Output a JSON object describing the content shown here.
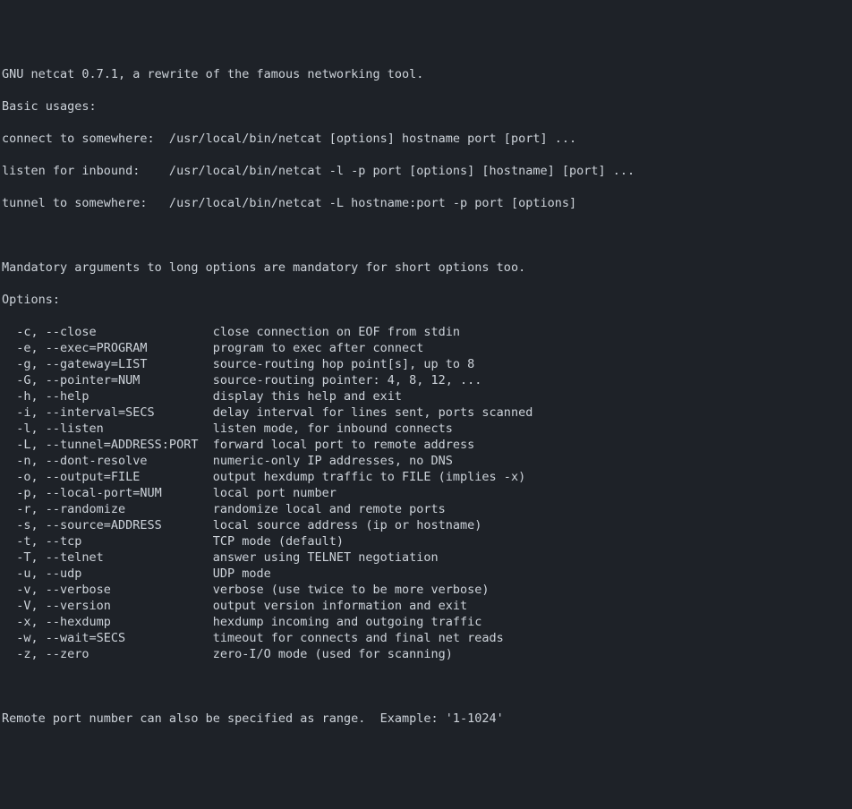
{
  "header": "GNU netcat 0.7.1, a rewrite of the famous networking tool.",
  "usages_title": "Basic usages:",
  "usages": [
    "connect to somewhere:  /usr/local/bin/netcat [options] hostname port [port] ...",
    "listen for inbound:    /usr/local/bin/netcat -l -p port [options] [hostname] [port] ...",
    "tunnel to somewhere:   /usr/local/bin/netcat -L hostname:port -p port [options]"
  ],
  "mandatory": "Mandatory arguments to long options are mandatory for short options too.",
  "options_title": "Options:",
  "options": [
    {
      "flag": "  -c, --close",
      "desc": "close connection on EOF from stdin"
    },
    {
      "flag": "  -e, --exec=PROGRAM",
      "desc": "program to exec after connect"
    },
    {
      "flag": "  -g, --gateway=LIST",
      "desc": "source-routing hop point[s], up to 8"
    },
    {
      "flag": "  -G, --pointer=NUM",
      "desc": "source-routing pointer: 4, 8, 12, ..."
    },
    {
      "flag": "  -h, --help",
      "desc": "display this help and exit"
    },
    {
      "flag": "  -i, --interval=SECS",
      "desc": "delay interval for lines sent, ports scanned"
    },
    {
      "flag": "  -l, --listen",
      "desc": "listen mode, for inbound connects"
    },
    {
      "flag": "  -L, --tunnel=ADDRESS:PORT",
      "desc": "forward local port to remote address"
    },
    {
      "flag": "  -n, --dont-resolve",
      "desc": "numeric-only IP addresses, no DNS"
    },
    {
      "flag": "  -o, --output=FILE",
      "desc": "output hexdump traffic to FILE (implies -x)"
    },
    {
      "flag": "  -p, --local-port=NUM",
      "desc": "local port number"
    },
    {
      "flag": "  -r, --randomize",
      "desc": "randomize local and remote ports"
    },
    {
      "flag": "  -s, --source=ADDRESS",
      "desc": "local source address (ip or hostname)"
    },
    {
      "flag": "  -t, --tcp",
      "desc": "TCP mode (default)"
    },
    {
      "flag": "  -T, --telnet",
      "desc": "answer using TELNET negotiation"
    },
    {
      "flag": "  -u, --udp",
      "desc": "UDP mode"
    },
    {
      "flag": "  -v, --verbose",
      "desc": "verbose (use twice to be more verbose)"
    },
    {
      "flag": "  -V, --version",
      "desc": "output version information and exit"
    },
    {
      "flag": "  -x, --hexdump",
      "desc": "hexdump incoming and outgoing traffic"
    },
    {
      "flag": "  -w, --wait=SECS",
      "desc": "timeout for connects and final net reads"
    },
    {
      "flag": "  -z, --zero",
      "desc": "zero-I/O mode (used for scanning)"
    }
  ],
  "footer": "Remote port number can also be specified as range.  Example: '1-1024'",
  "layout": {
    "flag_col_width": 29
  }
}
